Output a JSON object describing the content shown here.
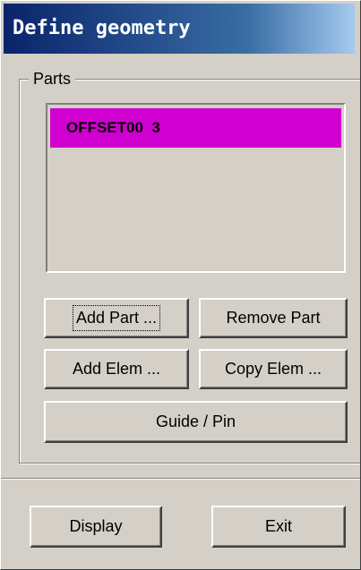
{
  "window": {
    "title": "Define geometry"
  },
  "parts_group": {
    "label": "Parts",
    "list_items": [
      {
        "name": "OFFSET00",
        "id": "3",
        "selected": true,
        "highlight_color": "#d000d0"
      }
    ]
  },
  "buttons": {
    "add_part": "Add Part ...",
    "remove_part": "Remove Part",
    "add_elem": "Add Elem ...",
    "copy_elem": "Copy Elem ...",
    "guide_pin": "Guide / Pin",
    "display": "Display",
    "exit": "Exit"
  },
  "colors": {
    "window_bg": "#d4d0c8",
    "title_bar": "#0a246a",
    "selection": "#d000d0"
  }
}
